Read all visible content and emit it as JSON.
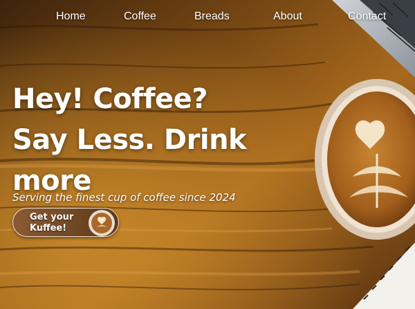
{
  "nav": {
    "items": [
      {
        "label": "Home"
      },
      {
        "label": "Coffee"
      },
      {
        "label": "Breads"
      },
      {
        "label": "About"
      },
      {
        "label": "Contact"
      }
    ]
  },
  "hero": {
    "title": "Hey! Coffee? Say Less. Drink more",
    "subtitle": "Serving the finest cup of coffee since 2024",
    "cta_label": "Get your Kuffee!"
  },
  "colors": {
    "wood_dark": "#3b220c",
    "wood_mid": "#8a5518",
    "wood_light": "#c98a2c",
    "accent_button": "#6f4624",
    "text": "#ffffff"
  },
  "icons": [
    "coffee-cup-icon",
    "latte-art-icon"
  ]
}
